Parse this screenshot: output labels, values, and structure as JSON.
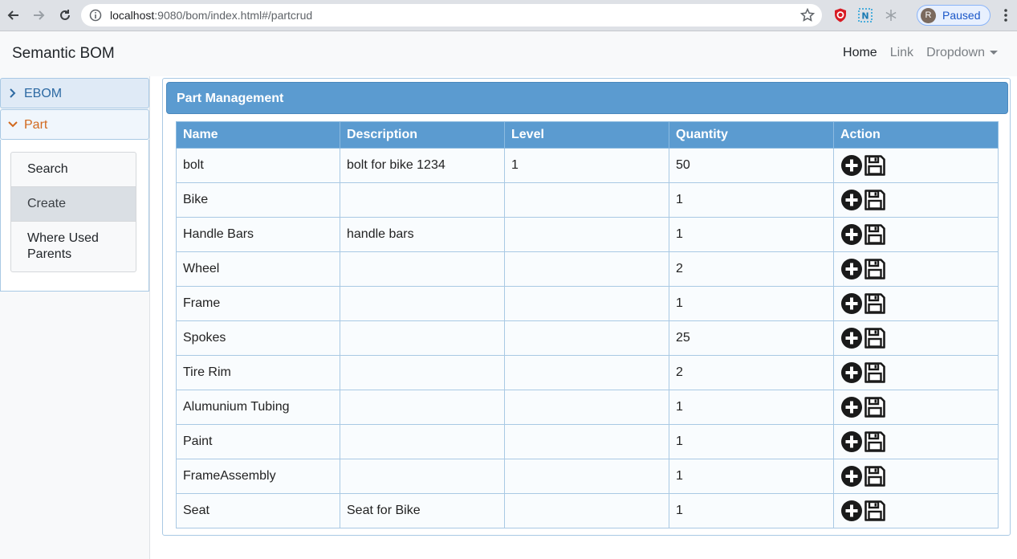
{
  "browser": {
    "url_host": "localhost",
    "url_rest": ":9080/bom/index.html#/partcrud",
    "profile_initial": "R",
    "profile_label": "Paused"
  },
  "navbar": {
    "brand": "Semantic BOM",
    "links": [
      "Home",
      "Link",
      "Dropdown"
    ]
  },
  "sidebar": {
    "sections": [
      {
        "label": "EBOM",
        "expanded": false
      },
      {
        "label": "Part",
        "expanded": true
      }
    ],
    "part_items": [
      "Search",
      "Create",
      "Where Used Parents"
    ],
    "active_item": "Create"
  },
  "panel": {
    "title": "Part Management"
  },
  "table": {
    "headers": [
      "Name",
      "Description",
      "Level",
      "Quantity",
      "Action"
    ],
    "rows": [
      {
        "name": "bolt",
        "description": "bolt for bike 1234",
        "level": "1",
        "quantity": "50"
      },
      {
        "name": "Bike",
        "description": "",
        "level": "",
        "quantity": "1"
      },
      {
        "name": "Handle Bars",
        "description": "handle bars",
        "level": "",
        "quantity": "1"
      },
      {
        "name": "Wheel",
        "description": "",
        "level": "",
        "quantity": "2"
      },
      {
        "name": "Frame",
        "description": "",
        "level": "",
        "quantity": "1"
      },
      {
        "name": "Spokes",
        "description": "",
        "level": "",
        "quantity": "25"
      },
      {
        "name": "Tire Rim",
        "description": "",
        "level": "",
        "quantity": "2"
      },
      {
        "name": "Alumunium Tubing",
        "description": "",
        "level": "",
        "quantity": "1"
      },
      {
        "name": "Paint",
        "description": "",
        "level": "",
        "quantity": "1"
      },
      {
        "name": "FrameAssembly",
        "description": "",
        "level": "",
        "quantity": "1"
      },
      {
        "name": "Seat",
        "description": "Seat for Bike",
        "level": "",
        "quantity": "1"
      }
    ],
    "row_actions": [
      "plus-circle-icon",
      "floppy-disk-icon"
    ]
  },
  "colors": {
    "header_blue": "#5b9bd0",
    "accent_orange": "#d2691e",
    "link_blue": "#2d6aa3"
  }
}
